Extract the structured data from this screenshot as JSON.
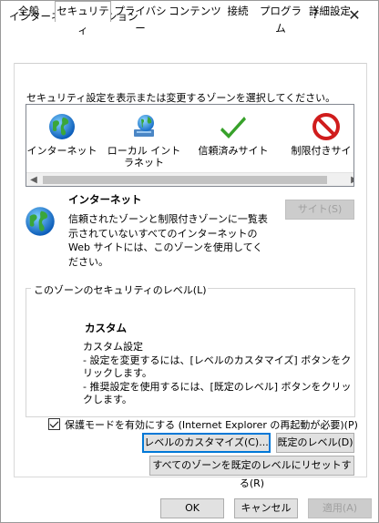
{
  "window": {
    "title": "インターネット オプション",
    "help": "?",
    "close": "✕"
  },
  "tabs": [
    {
      "label": "全般"
    },
    {
      "label": "セキュリティ",
      "active": true
    },
    {
      "label": "プライバシー"
    },
    {
      "label": "コンテンツ"
    },
    {
      "label": "接続"
    },
    {
      "label": "プログラム"
    },
    {
      "label": "詳細設定"
    }
  ],
  "security": {
    "select_label": "セキュリティ設定を表示または変更するゾーンを選択してください。",
    "zones": [
      {
        "label": "インターネット",
        "icon": "globe-icon",
        "selected": true
      },
      {
        "label": "ローカル イントラネット",
        "icon": "network-globe-icon"
      },
      {
        "label": "信頼済みサイト",
        "icon": "green-check-icon"
      },
      {
        "label": "制限付きサイト",
        "icon": "no-entry-icon"
      }
    ],
    "zone_info": {
      "name": "インターネット",
      "description": "信頼されたゾーンと制限付きゾーンに一覧表示されていないすべてのインターネットの Web サイトには、このゾーンを使用してください。",
      "sites_button": "サイト(S)"
    },
    "level_group_label": "このゾーンのセキュリティのレベル(L)",
    "custom_title": "カスタム",
    "custom_lines": [
      "カスタム設定",
      "- 設定を変更するには、[レベルのカスタマイズ] ボタンをクリックします。",
      "- 推奨設定を使用するには、[既定のレベル] ボタンをクリックします。"
    ],
    "protected_mode": {
      "checked": true,
      "label": "保護モードを有効にする (Internet Explorer の再起動が必要)(P)"
    },
    "customize_button": "レベルのカスタマイズ(C)...",
    "default_level_button": "既定のレベル(D)",
    "reset_all_button": "すべてのゾーンを既定のレベルにリセットする(R)"
  },
  "footer": {
    "ok": "OK",
    "cancel": "キャンセル",
    "apply": "適用(A)"
  },
  "colors": {
    "accent": "#0078d7",
    "check_green": "#37a12a",
    "no_entry_red": "#d01c1c",
    "disabled_text": "#a0a0a0"
  }
}
